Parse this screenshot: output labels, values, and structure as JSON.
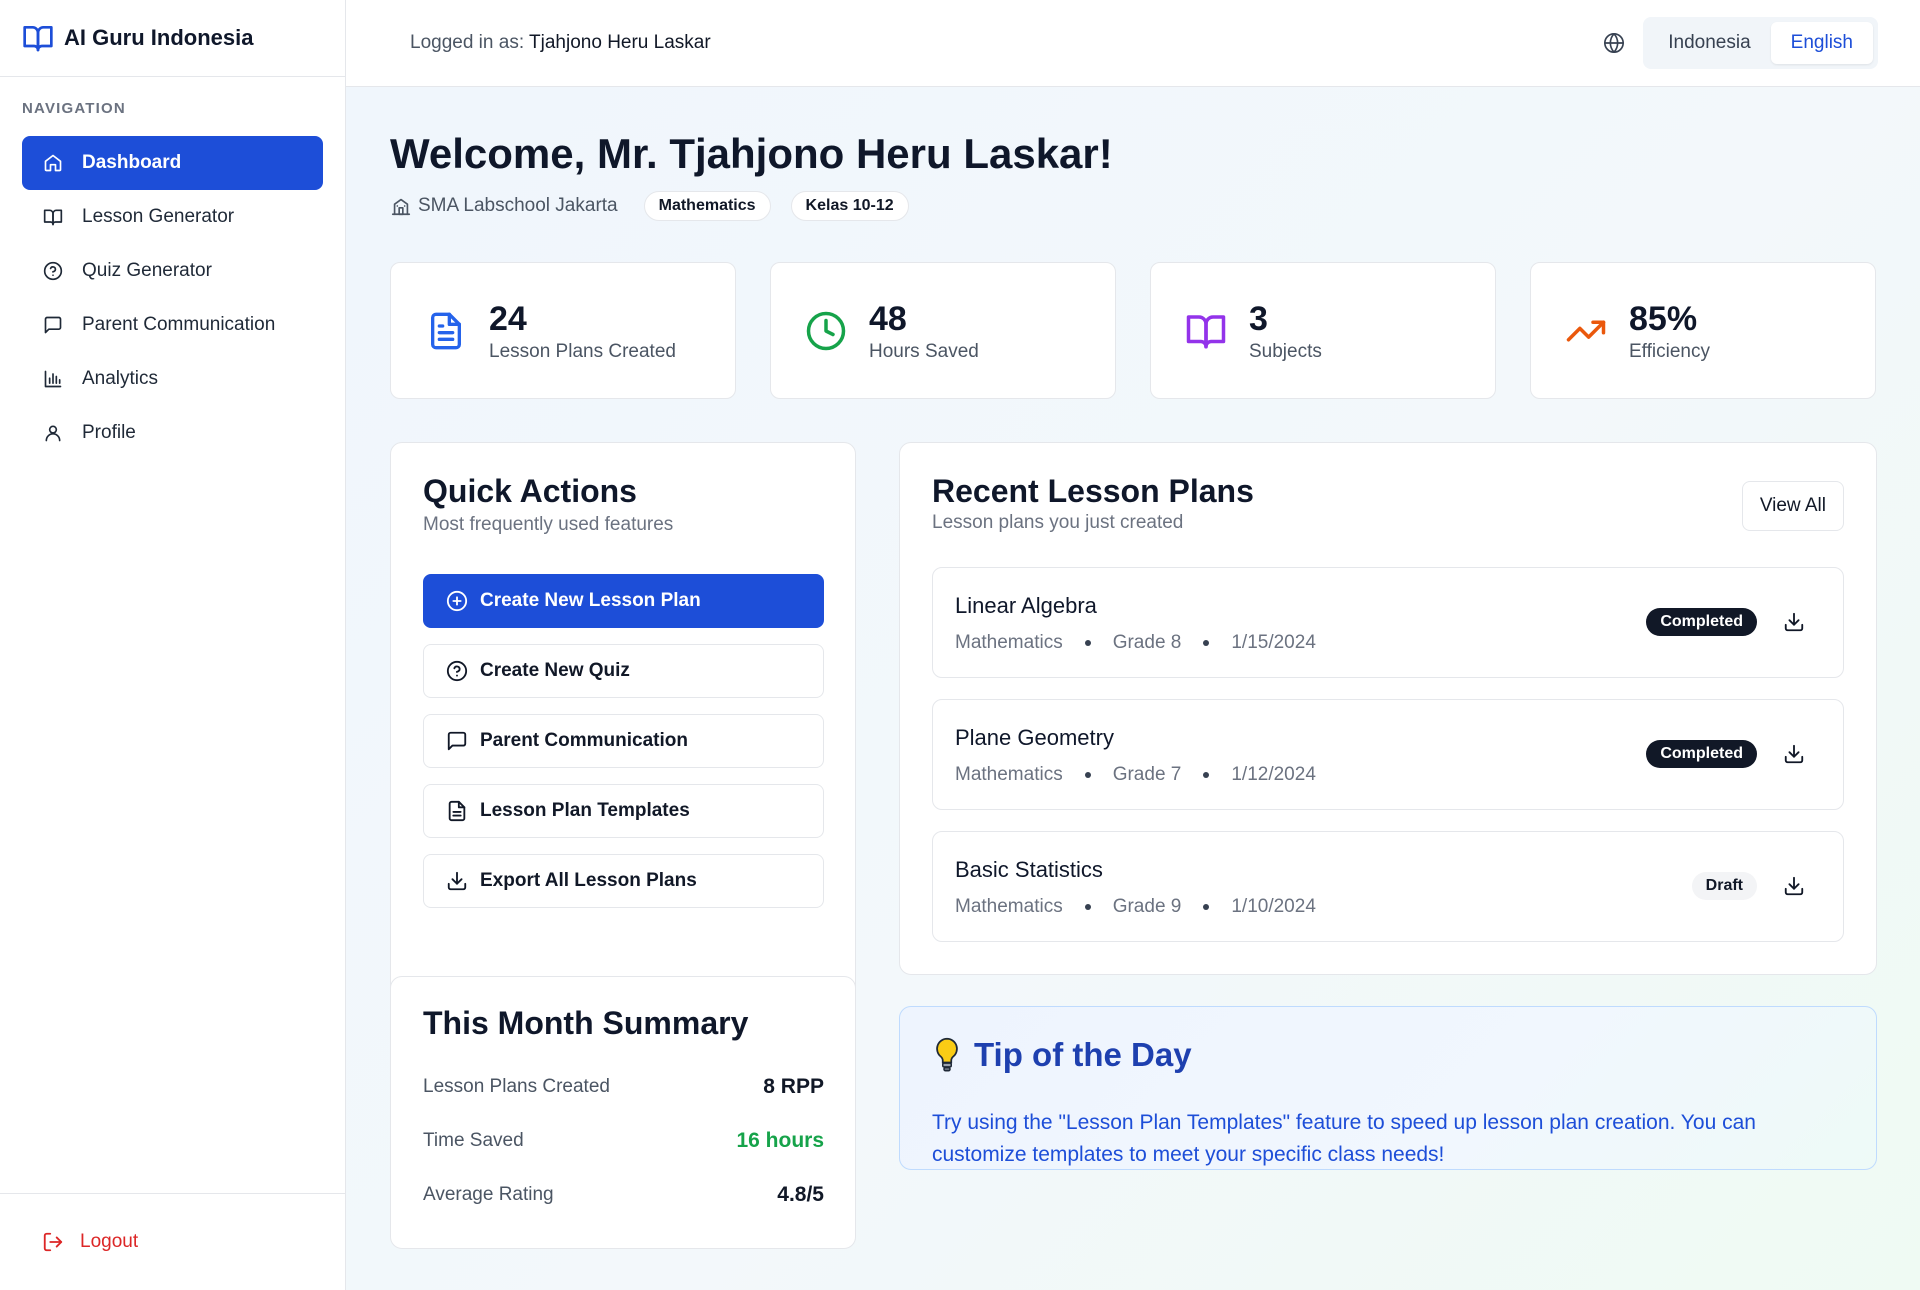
{
  "brand": {
    "name": "AI Guru Indonesia",
    "icon": "book-open-icon"
  },
  "nav": {
    "heading": "NAVIGATION",
    "items": [
      {
        "label": "Dashboard",
        "icon": "home-icon",
        "active": true
      },
      {
        "label": "Lesson Generator",
        "icon": "book-open-icon"
      },
      {
        "label": "Quiz Generator",
        "icon": "help-circle-icon"
      },
      {
        "label": "Parent Communication",
        "icon": "message-square-icon"
      },
      {
        "label": "Analytics",
        "icon": "bar-chart-icon"
      },
      {
        "label": "Profile",
        "icon": "user-icon"
      }
    ],
    "logout": "Logout"
  },
  "topbar": {
    "logged_prefix": "Logged in as:",
    "user": "Tjahjono Heru Laskar",
    "languages": [
      "Indonesia",
      "English"
    ],
    "active_language": "English"
  },
  "welcome": {
    "title": "Welcome, Mr. Tjahjono Heru Laskar!",
    "school": "SMA Labschool Jakarta",
    "subject_pill": "Mathematics",
    "grade_pill": "Kelas 10-12"
  },
  "stats": [
    {
      "value": "24",
      "label": "Lesson Plans Created",
      "icon": "file-text-icon",
      "color": "#2563eb"
    },
    {
      "value": "48",
      "label": "Hours Saved",
      "icon": "clock-icon",
      "color": "#16a34a"
    },
    {
      "value": "3",
      "label": "Subjects",
      "icon": "book-open-icon",
      "color": "#9333ea"
    },
    {
      "value": "85%",
      "label": "Efficiency",
      "icon": "trending-up-icon",
      "color": "#ea580c"
    }
  ],
  "quick_actions": {
    "title": "Quick Actions",
    "subtitle": "Most frequently used features",
    "buttons": [
      {
        "label": "Create New Lesson Plan",
        "icon": "plus-circle-icon"
      },
      {
        "label": "Create New Quiz",
        "icon": "help-circle-icon"
      },
      {
        "label": "Parent Communication",
        "icon": "message-square-icon"
      },
      {
        "label": "Lesson Plan Templates",
        "icon": "file-text-icon"
      },
      {
        "label": "Export All Lesson Plans",
        "icon": "download-icon"
      }
    ]
  },
  "summary": {
    "title": "This Month Summary",
    "rows": [
      {
        "label": "Lesson Plans Created",
        "value": "8 RPP"
      },
      {
        "label": "Time Saved",
        "value": "16 hours"
      },
      {
        "label": "Average Rating",
        "value": "4.8/5"
      }
    ]
  },
  "recent": {
    "title": "Recent Lesson Plans",
    "subtitle": "Lesson plans you just created",
    "view_all": "View All",
    "items": [
      {
        "title": "Linear Algebra",
        "subject": "Mathematics",
        "grade": "Grade 8",
        "date": "1/15/2024",
        "status": "Completed"
      },
      {
        "title": "Plane Geometry",
        "subject": "Mathematics",
        "grade": "Grade 7",
        "date": "1/12/2024",
        "status": "Completed"
      },
      {
        "title": "Basic Statistics",
        "subject": "Mathematics",
        "grade": "Grade 9",
        "date": "1/10/2024",
        "status": "Draft"
      }
    ]
  },
  "tip": {
    "title": "Tip of the Day",
    "icon": "lightbulb-icon",
    "text": "Try using the \"Lesson Plan Templates\" feature to speed up lesson plan creation. You can customize templates to meet your specific class needs!"
  }
}
